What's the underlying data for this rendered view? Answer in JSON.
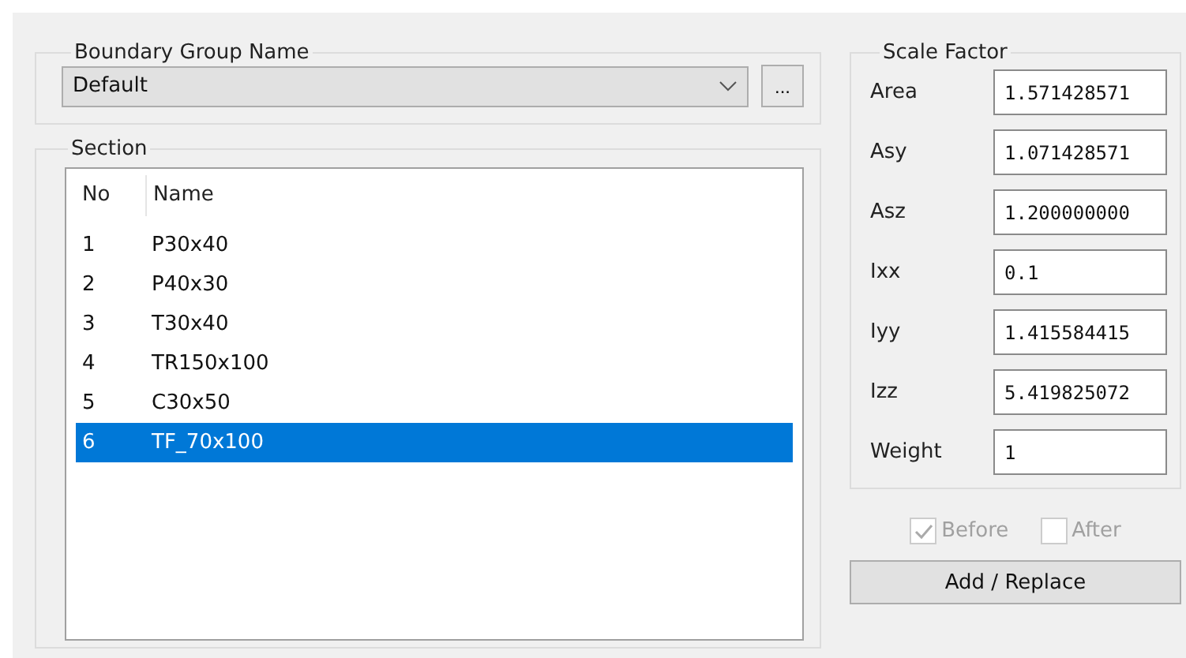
{
  "boundary_group": {
    "title": "Boundary Group Name",
    "dropdown": {
      "value": "Default"
    },
    "more_button": "..."
  },
  "section": {
    "title": "Section",
    "columns": [
      "No",
      "Name"
    ],
    "rows": [
      {
        "no": "1",
        "name": "P30x40",
        "selected": false
      },
      {
        "no": "2",
        "name": "P40x30",
        "selected": false
      },
      {
        "no": "3",
        "name": "T30x40",
        "selected": false
      },
      {
        "no": "4",
        "name": "TR150x100",
        "selected": false
      },
      {
        "no": "5",
        "name": "C30x50",
        "selected": false
      },
      {
        "no": "6",
        "name": "TF_70x100",
        "selected": true
      }
    ]
  },
  "scale_factor": {
    "title": "Scale Factor",
    "fields": [
      {
        "label": "Area",
        "value": "1.571428571"
      },
      {
        "label": "Asy",
        "value": "1.071428571"
      },
      {
        "label": "Asz",
        "value": "1.200000000"
      },
      {
        "label": "Ixx",
        "value": "0.1"
      },
      {
        "label": "Iyy",
        "value": "1.415584415"
      },
      {
        "label": "Izz",
        "value": "5.419825072"
      },
      {
        "label": "Weight",
        "value": "1"
      }
    ]
  },
  "options": [
    {
      "label": "Before",
      "checked": true,
      "disabled": true
    },
    {
      "label": "After",
      "checked": false,
      "disabled": true
    }
  ],
  "add_button": "Add / Replace"
}
